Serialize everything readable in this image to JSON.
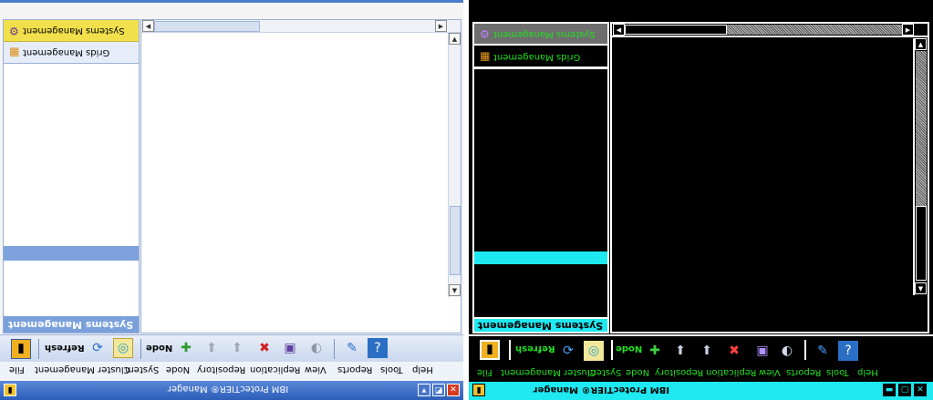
{
  "left_window": {
    "title": "IBM ProtecTIER® Manager",
    "nav": {
      "selected_label": "Systems Management",
      "other_label": "Grids Management",
      "footer_label": "Systems Management"
    },
    "toolbar": {
      "refresh_label": "Refresh",
      "node_label": "Node"
    },
    "menu": [
      "File",
      "Cluster Management",
      "System",
      "Node",
      "Repository",
      "Replication",
      "View",
      "Reports",
      "Tools",
      "Help"
    ]
  },
  "right_window": {
    "title": "IBM ProtecTIER® Manager",
    "nav": {
      "selected_label": "Systems Management",
      "other_label": "Grids Management",
      "footer_label": "Systems Management"
    },
    "toolbar": {
      "refresh_label": "Refresh",
      "node_label": "Node"
    },
    "menu": [
      "File",
      "Cluster Management",
      "System",
      "Node",
      "Repository",
      "Replication",
      "View",
      "Reports",
      "Tools",
      "Help"
    ]
  },
  "colors": {
    "standard_accent": "#4a7cc9",
    "standard_selected": "#f1e04c",
    "contrast_text": "#20e020",
    "contrast_accent": "#1ee8f0"
  },
  "icons": [
    "systems-icon",
    "grids-icon",
    "app-icon",
    "refresh-icon",
    "wizard-icon",
    "add-node-icon",
    "remove-node-icon",
    "delete-icon",
    "tools-icon",
    "help-icon"
  ]
}
